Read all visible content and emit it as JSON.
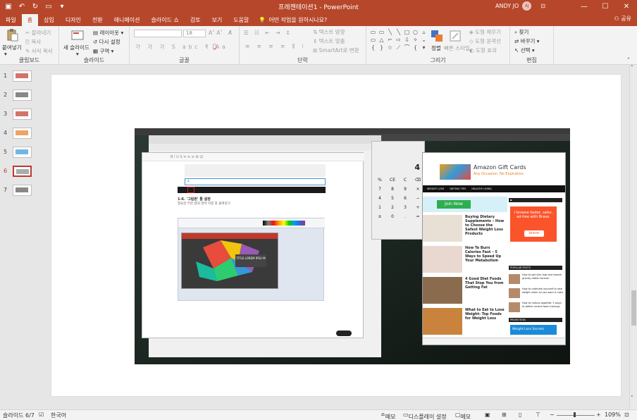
{
  "titlebar": {
    "title": "프레젠테이션1 - PowerPoint",
    "user": "ANDY JO",
    "user_initials": "AJ"
  },
  "tabs": [
    "파일",
    "홈",
    "삽입",
    "디자인",
    "전환",
    "애니메이션",
    "슬라이드 쇼",
    "검토",
    "보기",
    "도움말"
  ],
  "tell_me": "어떤 작업을 원하시나요?",
  "share": "공유",
  "ribbon": {
    "clipboard": {
      "label": "클립보드",
      "paste": "붙여넣기",
      "cut": "잘라내기",
      "copy": "복사",
      "format_painter": "서식 복사"
    },
    "slides": {
      "label": "슬라이드",
      "new_slide": "새 슬라이드",
      "layout": "레이아웃",
      "reset": "다시 설정",
      "section": "구역"
    },
    "font": {
      "label": "글꼴",
      "size": "18"
    },
    "paragraph": {
      "label": "단락",
      "text_direction": "텍스트 방향",
      "align_text": "텍스트 맞춤",
      "smartart": "SmartArt로 변환"
    },
    "drawing": {
      "label": "그리기",
      "arrange": "정렬",
      "quick_styles": "빠른 스타일",
      "fill": "도형 채우기",
      "outline": "도형 윤곽선",
      "effects": "도형 효과"
    },
    "editing": {
      "label": "편집",
      "find": "찾기",
      "replace": "바꾸기",
      "select": "선택"
    }
  },
  "thumbnails": [
    {
      "num": "1",
      "active": false
    },
    {
      "num": "2",
      "active": false
    },
    {
      "num": "3",
      "active": false
    },
    {
      "num": "4",
      "active": false
    },
    {
      "num": "5",
      "active": false
    },
    {
      "num": "6",
      "active": true
    },
    {
      "num": "7",
      "active": false
    }
  ],
  "status": {
    "slide_info": "슬라이드 6/7",
    "language": "한국어",
    "notes": "메모",
    "display_settings": "디스플레이 설정",
    "comments": "메모",
    "zoom": "109%"
  },
  "slide_picture": {
    "doc_heading": "1-6. '그림판' 툴 설정",
    "doc_text": "필요한 부분 캡처 영역 지정 후 붙여넣기",
    "chart_title": "TITLE LOREM IPSU M",
    "calc_display": "4",
    "calc_keys": [
      "%",
      "CE",
      "C",
      "⌫",
      "7",
      "8",
      "9",
      "×",
      "4",
      "5",
      "6",
      "−",
      "1",
      "2",
      "3",
      "+",
      "±",
      "0",
      ".",
      "="
    ],
    "ad_title": "Amazon Gift Cards",
    "ad_subtitle": "Any Occasion. No Expiration.",
    "nav": [
      "WEIGHT LOSS",
      "DIETING TIPS",
      "HEALTHY LIVING"
    ],
    "join_button": "Join Now",
    "articles": [
      {
        "title": "Buying Dietary Supplements – How to Choose the Safest Weight Loss Products"
      },
      {
        "title": "How To Burn Calories Fast – 5 Ways to Speed Up Your Metabolism"
      },
      {
        "title": "4 Good Diet Foods That Stop You from Getting Fat"
      },
      {
        "title": "What to Eat to Lose Weight: Top Foods for Weight Loss"
      }
    ],
    "brave_text": "I browse faster, safer, ad-free with Brave.",
    "brave_button": "brave",
    "popular_posts": "POPULAR POSTS",
    "promotion": "PROMOTION",
    "promo_text": "Weight Loss Secrets",
    "side_posts": [
      "How to get slim legs and banish gravity-ridden forever",
      "How to motivate yourself to lose weight when all you want is cake",
      "How to reduce appetite: 5 ways to better control food cravings"
    ]
  }
}
